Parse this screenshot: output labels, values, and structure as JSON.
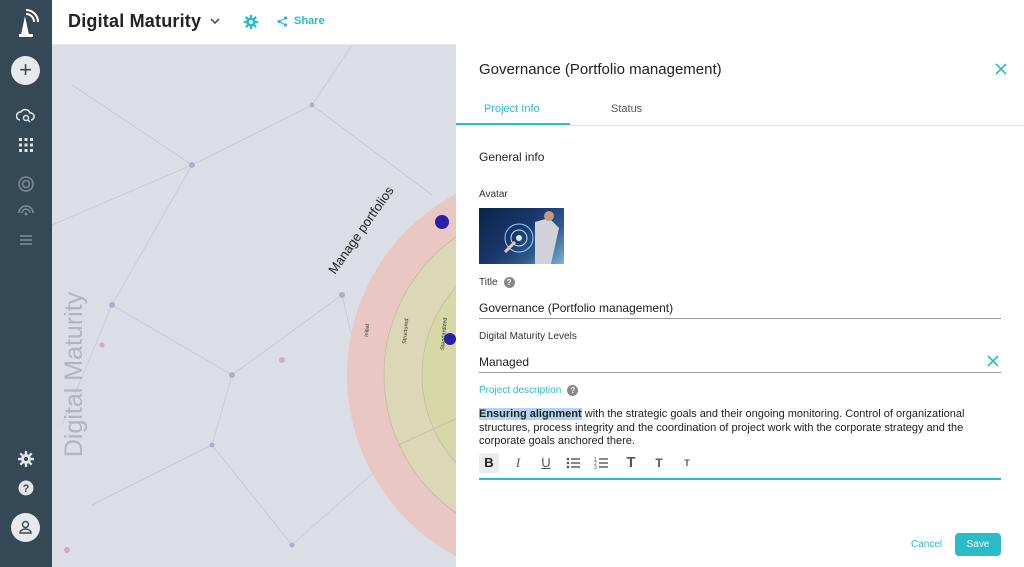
{
  "app": {
    "title": "Digital Maturity",
    "share_label": "Share",
    "canvas_title": "Digital Maturity",
    "ring_label": "Manage portfolios",
    "ring_levels": [
      "Initial",
      "Structured",
      "Standardized"
    ]
  },
  "colors": {
    "rail": "#344955",
    "accent": "#2bbcc9"
  },
  "panel": {
    "title": "Governance (Portfolio management)",
    "tabs": [
      {
        "label": "Project Info",
        "active": true
      },
      {
        "label": "Status",
        "active": false
      }
    ],
    "section_title": "General info",
    "avatar_label": "Avatar",
    "title_label": "Title",
    "title_value": "Governance (Portfolio management)",
    "levels_label": "Digital Maturity Levels",
    "levels_value": "Managed",
    "description_label": "Project description",
    "description_highlight": "Ensuring alignment",
    "description_rest": " with the strategic goals and their ongoing monitoring. Control of organizational structures, process integrity and the coordination of project work with the corporate strategy and the corporate goals anchored there.",
    "toolbar": [
      "bold",
      "italic",
      "underline",
      "bullet-list",
      "numbered-list",
      "heading-large",
      "heading-medium",
      "heading-small"
    ],
    "cancel_label": "Cancel",
    "save_label": "Save"
  },
  "icons": {
    "rail": [
      "logo-icon",
      "add-icon",
      "cloud-search-icon",
      "grid-icon",
      "target-icon",
      "radar-icon",
      "list-icon",
      "settings-icon",
      "help-icon",
      "user-icon"
    ]
  }
}
